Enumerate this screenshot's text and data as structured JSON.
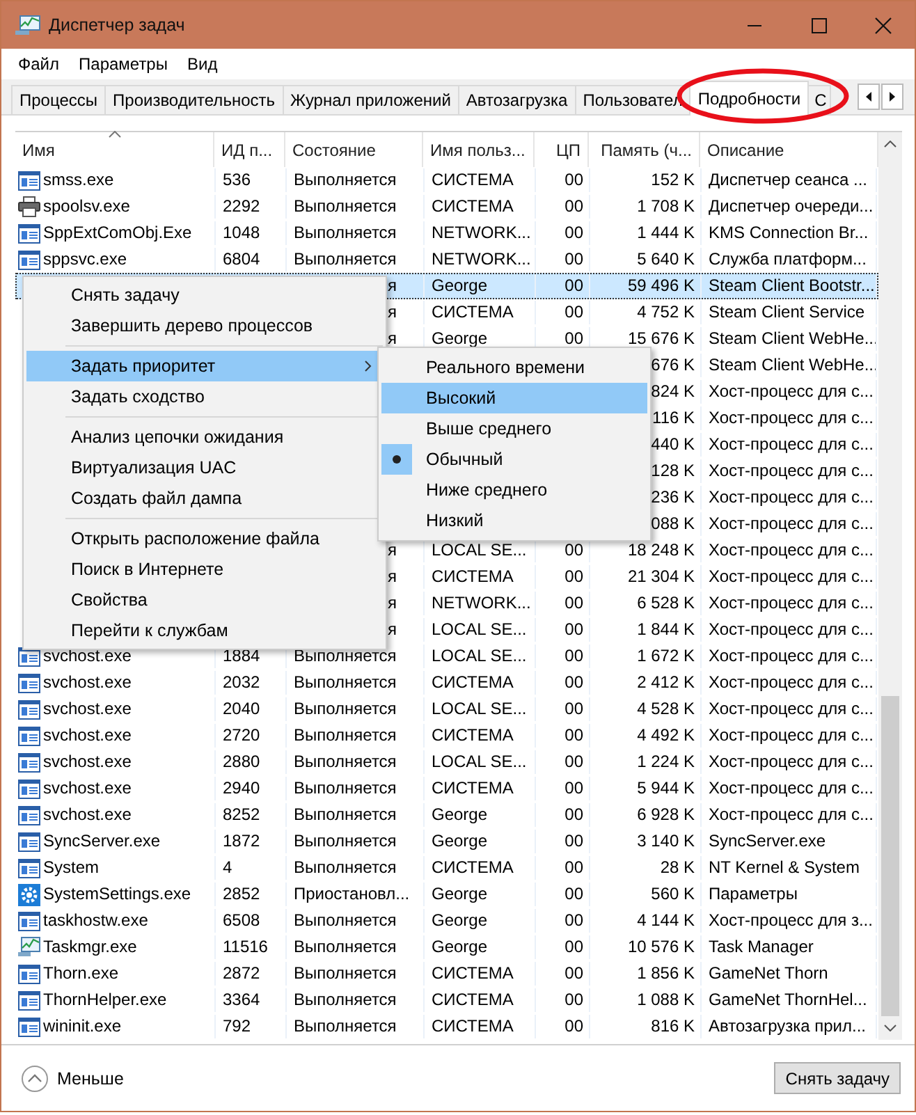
{
  "window": {
    "title": "Диспетчер задач"
  },
  "menu_bar": [
    "Файл",
    "Параметры",
    "Вид"
  ],
  "tabs": [
    {
      "label": "Процессы",
      "selected": false
    },
    {
      "label": "Производительность",
      "selected": false
    },
    {
      "label": "Журнал приложений",
      "selected": false
    },
    {
      "label": "Автозагрузка",
      "selected": false
    },
    {
      "label": "Пользовател",
      "selected": false
    },
    {
      "label": "Подробности",
      "selected": true
    },
    {
      "label": "С",
      "selected": false
    }
  ],
  "table": {
    "columns": [
      {
        "label": "Имя",
        "sorted": true
      },
      {
        "label": "ИД п...",
        "sorted": false
      },
      {
        "label": "Состояние",
        "sorted": false
      },
      {
        "label": "Имя польз...",
        "sorted": false
      },
      {
        "label": "ЦП",
        "sorted": false
      },
      {
        "label": "Память (ч...",
        "sorted": false
      },
      {
        "label": "Описание",
        "sorted": false
      }
    ],
    "rows": [
      {
        "kind": "app",
        "name": "smss.exe",
        "pid": "536",
        "status": "Выполняется",
        "user": "СИСТЕМА",
        "cpu": "00",
        "memory": "152 K",
        "description": "Диспетчер сеанса  ...",
        "selected": false
      },
      {
        "kind": "printer",
        "name": "spoolsv.exe",
        "pid": "2292",
        "status": "Выполняется",
        "user": "СИСТЕМА",
        "cpu": "00",
        "memory": "1 708 K",
        "description": "Диспетчер очереди...",
        "selected": false
      },
      {
        "kind": "app",
        "name": "SppExtComObj.Exe",
        "pid": "1048",
        "status": "Выполняется",
        "user": "NETWORK...",
        "cpu": "00",
        "memory": "1 444 K",
        "description": "KMS Connection Br...",
        "selected": false
      },
      {
        "kind": "app",
        "name": "sppsvc.exe",
        "pid": "6804",
        "status": "Выполняется",
        "user": "NETWORK...",
        "cpu": "00",
        "memory": "5 640 K",
        "description": "Служба платформ...",
        "selected": false
      },
      {
        "status_tail": "я",
        "user": "George",
        "cpu": "00",
        "memory": "59 496 K",
        "description": "Steam Client Bootstr...",
        "selected": true
      },
      {
        "status_tail": "я",
        "user": "СИСТЕМА",
        "cpu": "00",
        "memory": "4 752 K",
        "description": "Steam Client Service",
        "selected": false
      },
      {
        "status_tail": "я",
        "user": "George",
        "cpu": "00",
        "memory": "15 676 K",
        "description": "Steam Client WebHe...",
        "selected": false
      },
      {
        "memory": "676 K",
        "description": "Steam Client WebHe...",
        "selected": false
      },
      {
        "memory": "824 K",
        "description": "Хост-процесс для с...",
        "selected": false
      },
      {
        "memory": "116 K",
        "description": "Хост-процесс для с...",
        "selected": false
      },
      {
        "memory": "440 K",
        "description": "Хост-процесс для с...",
        "selected": false
      },
      {
        "memory": "128 K",
        "description": "Хост-процесс для с...",
        "selected": false
      },
      {
        "memory": "236 K",
        "description": "Хост-процесс для с...",
        "selected": false
      },
      {
        "memory": "088 K",
        "description": "Хост-процесс для с...",
        "selected": false
      },
      {
        "status_tail": "я",
        "user": "LOCAL SE...",
        "cpu": "00",
        "memory": "18 248 K",
        "description": "Хост-процесс для с...",
        "selected": false
      },
      {
        "status_tail": "я",
        "user": "СИСТЕМА",
        "cpu": "00",
        "memory": "21 304 K",
        "description": "Хост-процесс для с...",
        "selected": false
      },
      {
        "status_tail": "я",
        "user": "NETWORK...",
        "cpu": "00",
        "memory": "6 528 K",
        "description": "Хост-процесс для с...",
        "selected": false
      },
      {
        "status_tail": "я",
        "user": "LOCAL SE...",
        "cpu": "00",
        "memory": "1 844 K",
        "description": "Хост-процесс для с...",
        "selected": false
      },
      {
        "kind": "app",
        "name": "svchost.exe",
        "pid": "1884",
        "status": "Выполняется",
        "user": "LOCAL SE...",
        "cpu": "00",
        "memory": "1 672 K",
        "description": "Хост-процесс для с...",
        "selected": false
      },
      {
        "kind": "app",
        "name": "svchost.exe",
        "pid": "2032",
        "status": "Выполняется",
        "user": "СИСТЕМА",
        "cpu": "00",
        "memory": "2 412 K",
        "description": "Хост-процесс для с...",
        "selected": false
      },
      {
        "kind": "app",
        "name": "svchost.exe",
        "pid": "2040",
        "status": "Выполняется",
        "user": "LOCAL SE...",
        "cpu": "00",
        "memory": "4 528 K",
        "description": "Хост-процесс для с...",
        "selected": false
      },
      {
        "kind": "app",
        "name": "svchost.exe",
        "pid": "2720",
        "status": "Выполняется",
        "user": "СИСТЕМА",
        "cpu": "00",
        "memory": "4 492 K",
        "description": "Хост-процесс для с...",
        "selected": false
      },
      {
        "kind": "app",
        "name": "svchost.exe",
        "pid": "2880",
        "status": "Выполняется",
        "user": "LOCAL SE...",
        "cpu": "00",
        "memory": "1 224 K",
        "description": "Хост-процесс для с...",
        "selected": false
      },
      {
        "kind": "app",
        "name": "svchost.exe",
        "pid": "2940",
        "status": "Выполняется",
        "user": "СИСТЕМА",
        "cpu": "00",
        "memory": "5 944 K",
        "description": "Хост-процесс для с...",
        "selected": false
      },
      {
        "kind": "app",
        "name": "svchost.exe",
        "pid": "8252",
        "status": "Выполняется",
        "user": "George",
        "cpu": "00",
        "memory": "6 928 K",
        "description": "Хост-процесс для с...",
        "selected": false
      },
      {
        "kind": "app",
        "name": "SyncServer.exe",
        "pid": "1872",
        "status": "Выполняется",
        "user": "George",
        "cpu": "00",
        "memory": "3 140 K",
        "description": "SyncServer.exe",
        "selected": false
      },
      {
        "kind": "app",
        "name": "System",
        "pid": "4",
        "status": "Выполняется",
        "user": "СИСТЕМА",
        "cpu": "00",
        "memory": "28 K",
        "description": "NT Kernel & System",
        "selected": false
      },
      {
        "kind": "gear",
        "name": "SystemSettings.exe",
        "pid": "2852",
        "status": "Приостановл...",
        "user": "George",
        "cpu": "00",
        "memory": "560 K",
        "description": "Параметры",
        "selected": false
      },
      {
        "kind": "app",
        "name": "taskhostw.exe",
        "pid": "6508",
        "status": "Выполняется",
        "user": "George",
        "cpu": "00",
        "memory": "4 144 K",
        "description": "Хост-процесс для з...",
        "selected": false
      },
      {
        "kind": "monitor",
        "name": "Taskmgr.exe",
        "pid": "11516",
        "status": "Выполняется",
        "user": "George",
        "cpu": "00",
        "memory": "10 576 K",
        "description": "Task Manager",
        "selected": false
      },
      {
        "kind": "app",
        "name": "Thorn.exe",
        "pid": "2872",
        "status": "Выполняется",
        "user": "СИСТЕМА",
        "cpu": "00",
        "memory": "1 856 K",
        "description": "GameNet Thorn",
        "selected": false
      },
      {
        "kind": "app",
        "name": "ThornHelper.exe",
        "pid": "3364",
        "status": "Выполняется",
        "user": "СИСТЕМА",
        "cpu": "00",
        "memory": "1 088 K",
        "description": "GameNet ThornHel...",
        "selected": false
      },
      {
        "kind": "app",
        "name": "wininit.exe",
        "pid": "792",
        "status": "Выполняется",
        "user": "СИСТЕМА",
        "cpu": "00",
        "memory": "816 K",
        "description": "Автозагрузка прил...",
        "selected": false
      }
    ]
  },
  "context_menu": {
    "groups": [
      [
        {
          "label": "Снять задачу",
          "selected": false,
          "submenu": false
        },
        {
          "label": "Завершить дерево процессов",
          "selected": false,
          "submenu": false
        }
      ],
      [
        {
          "label": "Задать приоритет",
          "selected": true,
          "submenu": true
        },
        {
          "label": "Задать сходство",
          "selected": false,
          "submenu": false
        }
      ],
      [
        {
          "label": "Анализ цепочки ожидания",
          "selected": false,
          "submenu": false
        },
        {
          "label": "Виртуализация UAC",
          "selected": false,
          "submenu": false
        },
        {
          "label": "Создать файл дампа",
          "selected": false,
          "submenu": false
        }
      ],
      [
        {
          "label": "Открыть расположение файла",
          "selected": false,
          "submenu": false
        },
        {
          "label": "Поиск в Интернете",
          "selected": false,
          "submenu": false
        },
        {
          "label": "Свойства",
          "selected": false,
          "submenu": false
        },
        {
          "label": "Перейти к службам",
          "selected": false,
          "submenu": false
        }
      ]
    ]
  },
  "priority_submenu": [
    {
      "label": "Реального времени",
      "selected": false,
      "checked": false
    },
    {
      "label": "Высокий",
      "selected": true,
      "checked": false
    },
    {
      "label": "Выше среднего",
      "selected": false,
      "checked": false
    },
    {
      "label": "Обычный",
      "selected": false,
      "checked": true
    },
    {
      "label": "Ниже среднего",
      "selected": false,
      "checked": false
    },
    {
      "label": "Низкий",
      "selected": false,
      "checked": false
    }
  ],
  "footer": {
    "toggle": "Меньше",
    "button": "Снять задачу"
  }
}
